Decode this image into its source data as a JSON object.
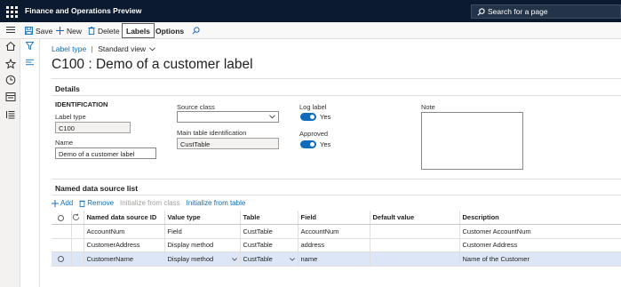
{
  "app": {
    "title": "Finance and Operations Preview",
    "search_placeholder": "Search for a page"
  },
  "actionpane": {
    "save": "Save",
    "new": "New",
    "delete": "Delete",
    "tab_labels": "Labels",
    "tab_options": "Options"
  },
  "breadcrumb": {
    "form": "Label type",
    "separator": "|",
    "view": "Standard view"
  },
  "page": {
    "title": "C100 : Demo of a customer label"
  },
  "details": {
    "title": "Details",
    "identification_group": "IDENTIFICATION",
    "label_type_label": "Label type",
    "label_type_value": "C100",
    "name_label": "Name",
    "name_value": "Demo of a customer label",
    "source_class_label": "Source class",
    "source_class_value": "",
    "main_table_label": "Main table identification",
    "main_table_value": "CustTable",
    "log_label_label": "Log label",
    "log_label_value": "Yes",
    "approved_label": "Approved",
    "approved_value": "Yes",
    "note_label": "Note"
  },
  "datasources": {
    "title": "Named data source list",
    "toolbar": {
      "add": "Add",
      "remove": "Remove",
      "init_class": "Initialize from class",
      "init_table": "Initialize from table"
    },
    "columns": [
      "Named data source ID",
      "Value type",
      "Table",
      "Field",
      "Default value",
      "Description"
    ],
    "rows": [
      {
        "id": "AccountNum",
        "value_type": "Field",
        "table": "CustTable",
        "field": "AccountNum",
        "default": "",
        "description": "Customer AccountNum"
      },
      {
        "id": "CustomerAddress",
        "value_type": "Display method",
        "table": "CustTable",
        "field": "address",
        "default": "",
        "description": "Customer Address"
      },
      {
        "id": "CustomerName",
        "value_type": "Display method",
        "table": "CustTable",
        "field": "name",
        "default": "",
        "description": "Name of the Customer"
      }
    ]
  },
  "icons": {
    "waffle": "app-launcher-icon",
    "search": "search-icon",
    "save": "save-icon",
    "new": "plus-icon",
    "delete": "trash-icon",
    "find": "search-icon",
    "nav": [
      "hamburger-icon",
      "home-icon",
      "star-icon",
      "clock-icon",
      "workspace-icon",
      "list-icon"
    ],
    "filter": "filter-icon"
  },
  "colors": {
    "topbar": "#0b1a2e",
    "accent": "#0f6cbd",
    "selected_row": "#dce6f7"
  }
}
